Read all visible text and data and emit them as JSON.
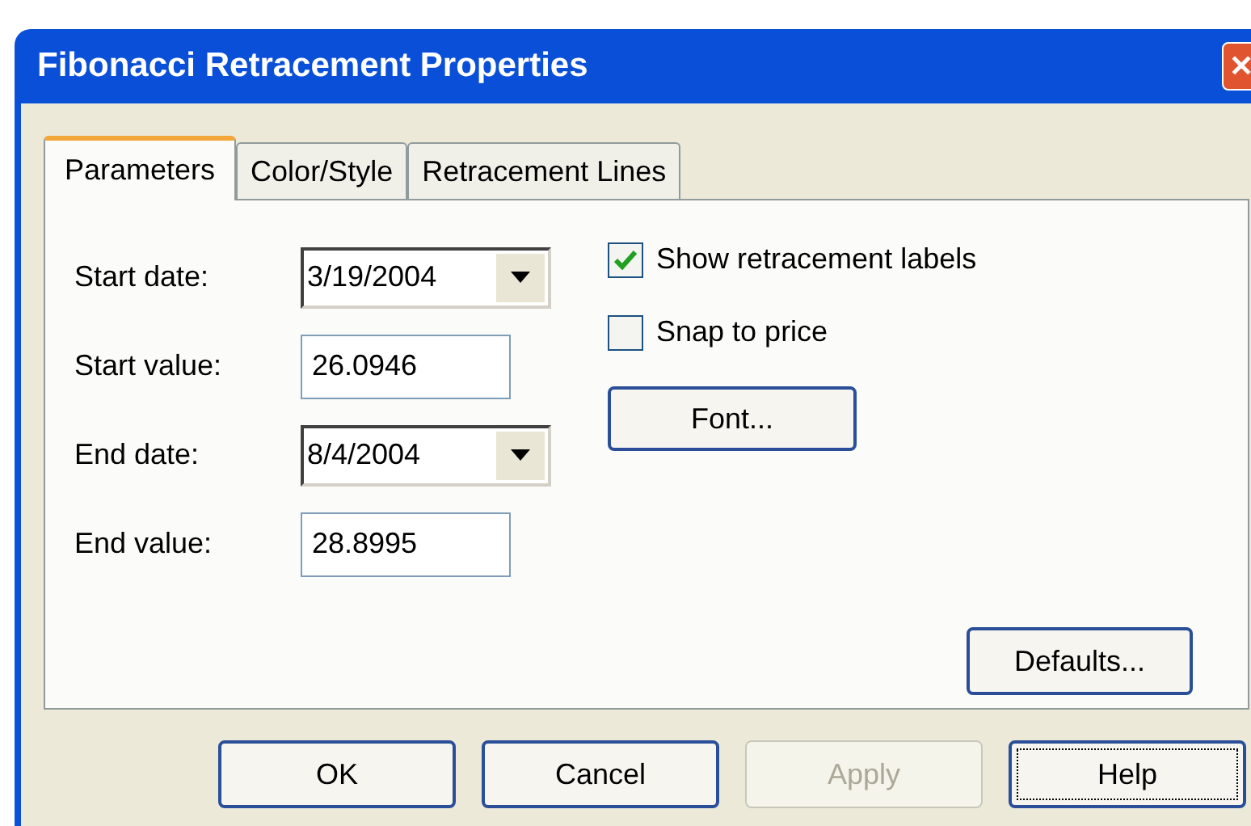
{
  "window": {
    "title": "Fibonacci Retracement Properties",
    "close": "✕"
  },
  "tabs": [
    {
      "label": "Parameters",
      "selected": true
    },
    {
      "label": "Color/Style",
      "selected": false
    },
    {
      "label": "Retracement Lines",
      "selected": false
    }
  ],
  "fields": [
    {
      "kind": "combo",
      "label": "Start date:",
      "value": "3/19/2004"
    },
    {
      "kind": "text",
      "label": "Start value:",
      "value": "26.0946"
    },
    {
      "kind": "combo",
      "label": "End date:",
      "value": "8/4/2004"
    },
    {
      "kind": "text",
      "label": "End value:",
      "value": "28.8995"
    }
  ],
  "checkboxes": [
    {
      "label": "Show retracement labels",
      "checked": true
    },
    {
      "label": "Snap to price",
      "checked": false
    }
  ],
  "font_button": "Font...",
  "defaults_button": "Defaults...",
  "buttons": [
    {
      "label": "OK",
      "disabled": false,
      "focused": false
    },
    {
      "label": "Cancel",
      "disabled": false,
      "focused": false
    },
    {
      "label": "Apply",
      "disabled": true,
      "focused": false
    },
    {
      "label": "Help",
      "disabled": false,
      "focused": true
    }
  ]
}
